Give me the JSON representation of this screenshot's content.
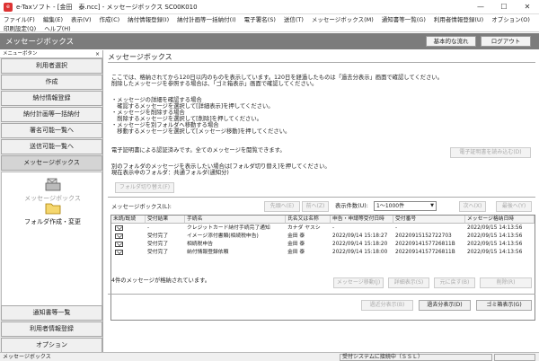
{
  "window": {
    "title": "e-Taxソフト - [金田　泰.ncc] - メッセージボックス SC00K010",
    "icon_text": "e",
    "minimize": "—",
    "maximize": "☐",
    "close": "✕"
  },
  "menu": {
    "row1": [
      "ファイル(F)",
      "編集(E)",
      "表示(V)",
      "作成(C)",
      "納付情報登録(I)",
      "納付計画等一括納付(I)",
      "電子署名(S)",
      "送信(T)",
      "メッセージボックス(M)",
      "通知書等一覧(G)",
      "利用者情報登録(U)",
      "オプション(O)"
    ],
    "row2": [
      "印刷設定(Q)",
      "ヘルプ(H)"
    ]
  },
  "header": {
    "title": "メッセージボックス",
    "basic_flow": "基本的な流れ",
    "logout": "ログアウト"
  },
  "leftnav": {
    "head": "メニューボタン",
    "close": "×",
    "top_items": [
      "利用者選択",
      "作成",
      "納付情報登録",
      "納付計画等一括納付",
      "署名可能一覧へ",
      "送信可能一覧へ",
      "メッセージボックス"
    ],
    "tools": [
      {
        "label": "メッセージボックス",
        "icon": "mailbox-icon"
      },
      {
        "label": "フォルダ作成・変更",
        "icon": "folder-icon"
      }
    ],
    "bottom_items": [
      "通知書等一覧",
      "利用者情報登録",
      "オプション"
    ]
  },
  "main": {
    "title": "メッセージボックス",
    "intro": [
      "ここでは、格納されてから120日以内のものを表示しています。120日を経過したものは「過去分表示」画面で確認してください。",
      "削除したメッセージを参照する場合は、「ゴミ箱表示」画面で確認してください。"
    ],
    "instructions": [
      "・メッセージの詳細を確認する場合",
      "　確認するメッセージを選択して[詳細表示]を押してください。",
      "・メッセージを削除する場合",
      "　削除するメッセージを選択して[削除]を押してください。",
      "・メッセージを別フォルダへ移動する場合",
      "　移動するメッセージを選択して[メッセージ移動]を押してください。"
    ],
    "cert_text": "電子証明書による認証済みです。全てのメッセージを閲覧できます。",
    "read_cert_button": "電子証明書を読み込む(D)",
    "folder_text": [
      "別のフォルダのメッセージを表示したい場合は[フォルダ切り替え]を押してください。",
      "現在表示中のフォルダ：共通フォルダ(通知分)"
    ],
    "folder_switch_button": "フォルダ切り替え(F)",
    "msgbox_label": "メッセージボックス(L):",
    "first_button": "先頭へ(E)",
    "prev_button": "前へ(Z)",
    "display_count_label": "表示件数(U):",
    "display_count_value": "1～1000件",
    "next_button": "次へ(X)",
    "last_button": "最後へ(Y)",
    "table": {
      "columns": [
        "未読/既読",
        "受付結果",
        "手続名",
        "氏名又は名称",
        "申告・申請等受付日時",
        "受付番号",
        "メッセージ格納日時"
      ],
      "rows": [
        [
          "unread",
          "-",
          "クレジットカード納付手続完了通知",
          "カナダ ヤスシ",
          "-",
          "-",
          "2022/09/15 14:13:56"
        ],
        [
          "read",
          "受付完了",
          "イメージ添付書類(相続税申告)",
          "金田 泰",
          "2022/09/14 15:18:27",
          "20220915152722703",
          "2022/09/15 14:13:56"
        ],
        [
          "read",
          "受付完了",
          "相続税申告",
          "金田 泰",
          "2022/09/14 15:18:20",
          "20220914157726811B",
          "2022/09/15 14:13:56"
        ],
        [
          "read",
          "受付完了",
          "納付情報登録依頼",
          "金田 泰",
          "2022/09/14 15:18:00",
          "20220914157726811B",
          "2022/09/15 14:13:56"
        ]
      ]
    },
    "count_text": "4件のメッセージが格納されています。",
    "move_button": "メッセージ移動(J)",
    "detail_button": "詳細表示(S)",
    "undo_button": "元に戻す(B)",
    "delete_button": "削除(R)",
    "recent_button": "過近分表示(B)",
    "past_button": "過去分表示(D)",
    "trash_button": "ゴミ箱表示(G)"
  },
  "status": {
    "left": "メッセージボックス",
    "connection": "受付システムに接続中（ＳＳＬ）"
  }
}
